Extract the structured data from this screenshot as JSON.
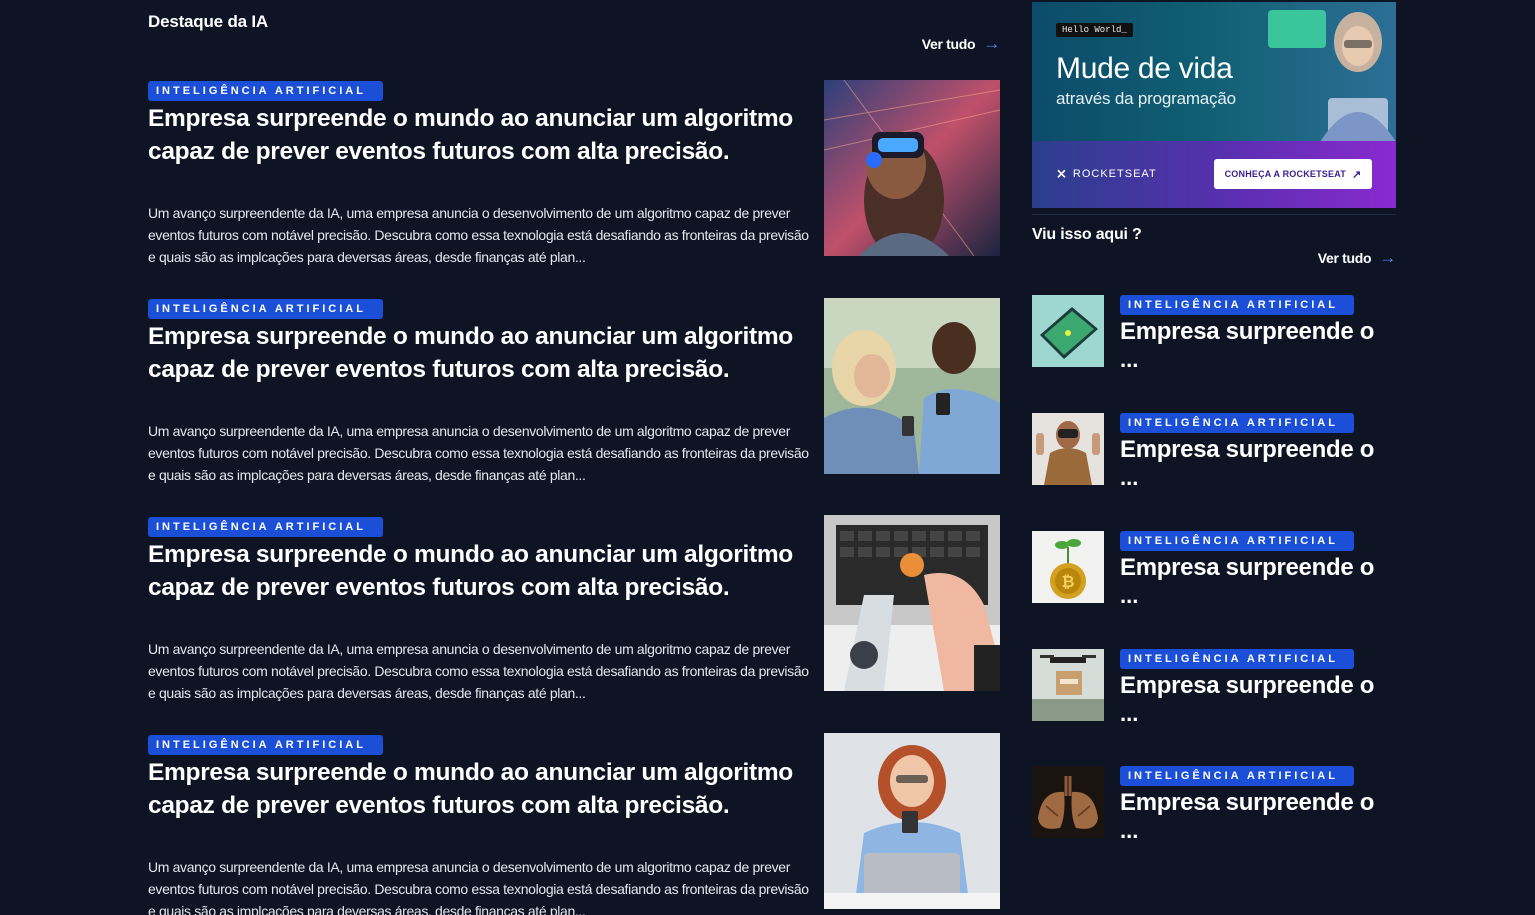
{
  "main": {
    "section_title": "Destaque da IA",
    "see_all_label": "Ver tudo",
    "see_all_icon": "arrow-right-icon",
    "articles": [
      {
        "tag": "INTELIGÊNCIA ARTIFICIAL",
        "headline": "Empresa surpreende o mundo ao anunciar um algoritmo capaz de prever eventos futuros com alta precisão.",
        "summary": "Um avanço surpreendente da IA, uma empresa anuncia o desenvolvimento de um algoritmo capaz de prever eventos futuros com notável precisão. Descubra como essa texnologia está desafiando as fronteiras da previsão e quais são as implcações para deversas áreas, desde finanças até plan...",
        "image": "woman-vr-headset-photo"
      },
      {
        "tag": "INTELIGÊNCIA ARTIFICIAL",
        "headline": "Empresa surpreende o mundo ao anunciar um algoritmo capaz de prever eventos futuros com alta precisão.",
        "summary": "Um avanço surpreendente da IA, uma empresa anuncia o desenvolvimento de um algoritmo capaz de prever eventos futuros com notável precisão. Descubra como essa texnologia está desafiando as fronteiras da previsão e quais são as implcações para deversas áreas, desde finanças até plan...",
        "image": "two-people-phones-photo"
      },
      {
        "tag": "INTELIGÊNCIA ARTIFICIAL",
        "headline": "Empresa surpreende o mundo ao anunciar um algoritmo capaz de prever eventos futuros com alta precisão.",
        "summary": "Um avanço surpreendente da IA, uma empresa anuncia o desenvolvimento de um algoritmo capaz de prever eventos futuros com notável precisão. Descubra como essa texnologia está desafiando as fronteiras da previsão e quais são as implcações para deversas áreas, desde finanças até plan...",
        "image": "robot-and-human-hands-keyboard-photo"
      },
      {
        "tag": "INTELIGÊNCIA ARTIFICIAL",
        "headline": "Empresa surpreende o mundo ao anunciar um algoritmo capaz de prever eventos futuros com alta precisão.",
        "summary": "Um avanço surpreendente da IA, uma empresa anuncia o desenvolvimento de um algoritmo capaz de prever eventos futuros com notável precisão. Descubra como essa texnologia está desafiando as fronteiras da previsão e quais são as implcações para deversas áreas, desde finanças até plan...",
        "image": "woman-smiling-phone-laptop-photo"
      }
    ]
  },
  "ad": {
    "hello": "Hello World_",
    "headline": "Mude de vida",
    "subheadline": "através da programação",
    "brand": "ROCKETSEAT",
    "cta": "CONHEÇA A ROCKETSEAT",
    "cta_icon": "arrow-up-right-icon"
  },
  "sidebar": {
    "title": "Viu isso aqui ?",
    "see_all_label": "Ver tudo",
    "items": [
      {
        "tag": "INTELIGÊNCIA ARTIFICIAL",
        "headline": "Empresa surpreende o",
        "ellipsis": "...",
        "image": "phone-map-photo"
      },
      {
        "tag": "INTELIGÊNCIA ARTIFICIAL",
        "headline": "Empresa surpreende o",
        "ellipsis": "...",
        "image": "man-vr-headset-photo"
      },
      {
        "tag": "INTELIGÊNCIA ARTIFICIAL",
        "headline": "Empresa surpreende o",
        "ellipsis": "...",
        "image": "bitcoin-plant-photo"
      },
      {
        "tag": "INTELIGÊNCIA ARTIFICIAL",
        "headline": "Empresa surpreende o",
        "ellipsis": "...",
        "image": "delivery-drone-photo"
      },
      {
        "tag": "INTELIGÊNCIA ARTIFICIAL",
        "headline": "Empresa surpreende o",
        "ellipsis": "...",
        "image": "lungs-render-photo"
      }
    ]
  },
  "colors": {
    "background": "#0e1424",
    "tag": "#1b4fd8",
    "accent_arrow": "#5b8cff"
  }
}
